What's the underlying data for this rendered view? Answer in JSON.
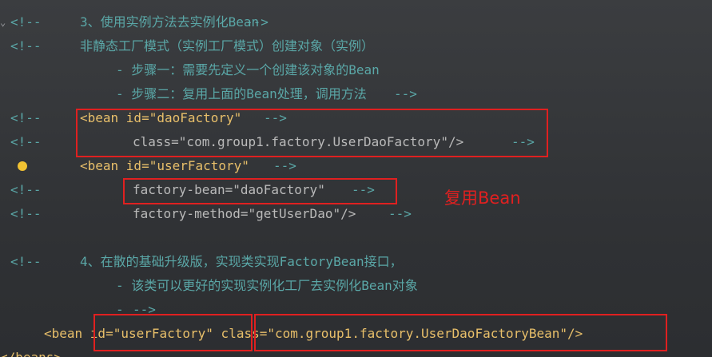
{
  "comment_open": "<!--",
  "comment_close": "-->",
  "lines": {
    "l1": "3、使用实例方法去实例化Bean",
    "l2": "非静态工厂模式（实例工厂模式）创建对象（实例）",
    "l3": "- 步骤一：需要先定义一个创建该对象的Bean",
    "l4": "- 步骤二：复用上面的Bean处理，调用方法",
    "l5": "<bean id=\"daoFactory\"",
    "l6": "class=\"com.group1.factory.UserDaoFactory\"/>",
    "l7": "<bean id=\"userFactory\"",
    "l8": "factory-bean=\"daoFactory\"",
    "l9": "factory-method=\"getUserDao\"/>",
    "l10": "4、在散的基础升级版，实现类实现FactoryBean接口，",
    "l11": "- 该类可以更好的实现实例化工厂去实例化Bean对象",
    "l12": "-",
    "l13": "<bean id=\"userFactory\" class=\"com.group1.factory.UserDaoFactoryBean\"/>",
    "l14": "</beans>"
  },
  "annotation": "复用Bean"
}
